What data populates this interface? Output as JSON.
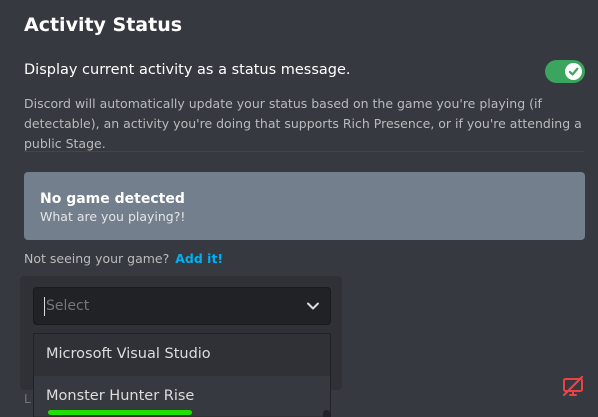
{
  "header": {
    "title": "Activity Status"
  },
  "activity": {
    "label": "Display current activity as a status message.",
    "toggle_on": true,
    "description": "Discord will automatically update your status based on the game you're playing (if detectable), an activity you're doing that supports Rich Presence, or if you're attending a public Stage."
  },
  "game": {
    "title": "No game detected",
    "subtitle": "What are you playing?!"
  },
  "add_game": {
    "prompt": "Not seeing your game?",
    "link": "Add it!"
  },
  "select": {
    "placeholder": "Select",
    "options": [
      {
        "label": "Microsoft Visual Studio"
      },
      {
        "label": "Monster Hunter Rise"
      }
    ]
  },
  "background": {
    "hidden_text": "L"
  },
  "icons": {
    "toggle": "check-icon",
    "chevron": "chevron-down-icon",
    "stream": "screen-share-off-icon"
  },
  "colors": {
    "background": "#36393f",
    "toggle_on": "#3ba55d",
    "game_box": "#747f8d",
    "link": "#00b0f4",
    "danger": "#ed4245",
    "annotation": "#20e000"
  }
}
